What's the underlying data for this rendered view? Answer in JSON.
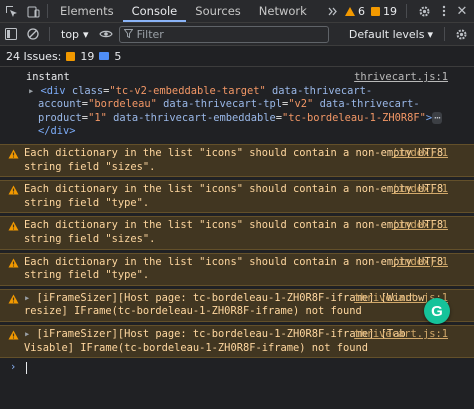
{
  "tabbar": {
    "tabs": [
      {
        "label": "Elements"
      },
      {
        "label": "Console"
      },
      {
        "label": "Sources"
      },
      {
        "label": "Network"
      }
    ],
    "warn_count": "6",
    "issue_count": "19"
  },
  "toolbar": {
    "context": "top",
    "filter_placeholder": "Filter",
    "levels": "Default levels"
  },
  "issues": {
    "label": "24 Issues:",
    "warn_count": "19",
    "info_count": "5"
  },
  "console": {
    "log1": {
      "label": "instant",
      "source": "thrivecart.js:1",
      "html": {
        "open": "<div",
        "attr1": "class",
        "val1": "\"tc-v2-embeddable-target\"",
        "attr2": "data-thrivecart-account",
        "val2": "\"bordeleau\"",
        "attr3": "data-thrivecart-tpl",
        "val3": "\"v2\"",
        "attr4": "data-thrivecart-product",
        "val4": "\"1\"",
        "attr5": "data-thrivecart-embeddable",
        "val5": "\"tc-bordeleau-1-ZH0R8F\"",
        "close": ">",
        "ellipsis": "⋯",
        "end": "</div>"
      }
    },
    "warnings": [
      {
        "text": "Each dictionary in the list \"icons\" should contain a non-empty UTF8 string field \"sizes\".",
        "source": "(index):1"
      },
      {
        "text": "Each dictionary in the list \"icons\" should contain a non-empty UTF8 string field \"type\".",
        "source": "(index):1"
      },
      {
        "text": "Each dictionary in the list \"icons\" should contain a non-empty UTF8 string field \"sizes\".",
        "source": "(index):1"
      },
      {
        "text": "Each dictionary in the list \"icons\" should contain a non-empty UTF8 string field \"type\".",
        "source": "(index):1"
      },
      {
        "text": "[iFrameSizer][Host page: tc-bordeleau-1-ZH0R8F-iframe] [Window resize] IFrame(tc-bordeleau-1-ZH0R8F-iframe) not found",
        "source": "thrivecart.js:1"
      },
      {
        "text": "[iFrameSizer][Host page: tc-bordeleau-1-ZH0R8F-iframe] [Tab Visable] IFrame(tc-bordeleau-1-ZH0R8F-iframe) not found",
        "source": "thrivecart.js:1"
      }
    ]
  },
  "fab": {
    "label": "G"
  }
}
